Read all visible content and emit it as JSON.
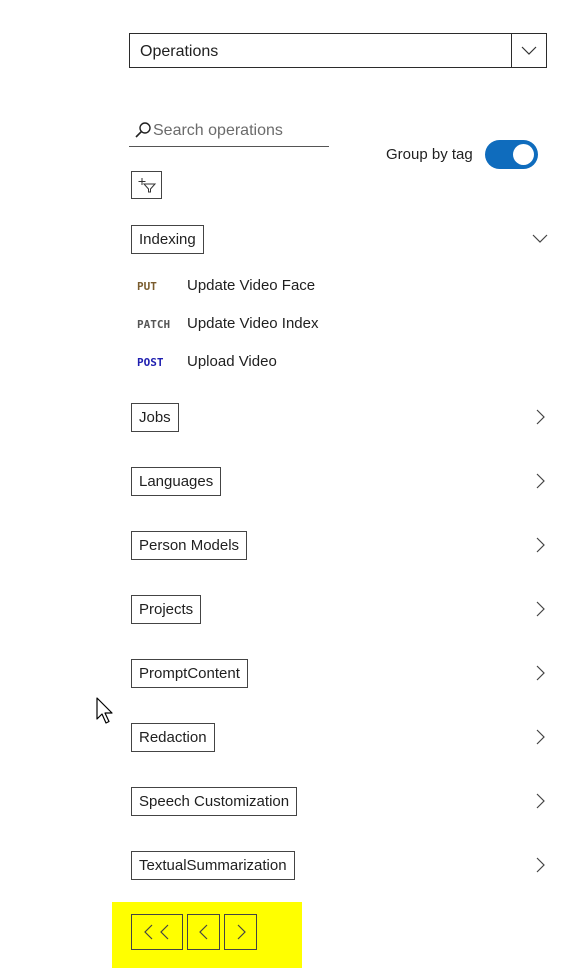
{
  "operations_dropdown": {
    "value": "Operations"
  },
  "search": {
    "placeholder": "Search operations"
  },
  "group_toggle": {
    "label": "Group by tag",
    "on": true
  },
  "tags": [
    {
      "label": "Indexing",
      "expanded": true
    },
    {
      "label": "Jobs",
      "expanded": false
    },
    {
      "label": "Languages",
      "expanded": false
    },
    {
      "label": "Person Models",
      "expanded": false
    },
    {
      "label": "Projects",
      "expanded": false
    },
    {
      "label": "PromptContent",
      "expanded": false
    },
    {
      "label": "Redaction",
      "expanded": false
    },
    {
      "label": "Speech Customization",
      "expanded": false
    },
    {
      "label": "TextualSummarization",
      "expanded": false
    }
  ],
  "indexing_operations": [
    {
      "method": "PUT",
      "name": "Update Video Face"
    },
    {
      "method": "PATCH",
      "name": "Update Video Index"
    },
    {
      "method": "POST",
      "name": "Upload Video"
    }
  ],
  "colors": {
    "put": "#7a5c2e",
    "patch": "#555555",
    "post": "#1f1fb0",
    "toggle_on": "#0f6cbd",
    "pager_highlight": "#ffff00"
  },
  "pager": {
    "first_icon": "double-chevron-left-icon",
    "prev_icon": "chevron-left-icon",
    "next_icon": "chevron-right-icon"
  }
}
